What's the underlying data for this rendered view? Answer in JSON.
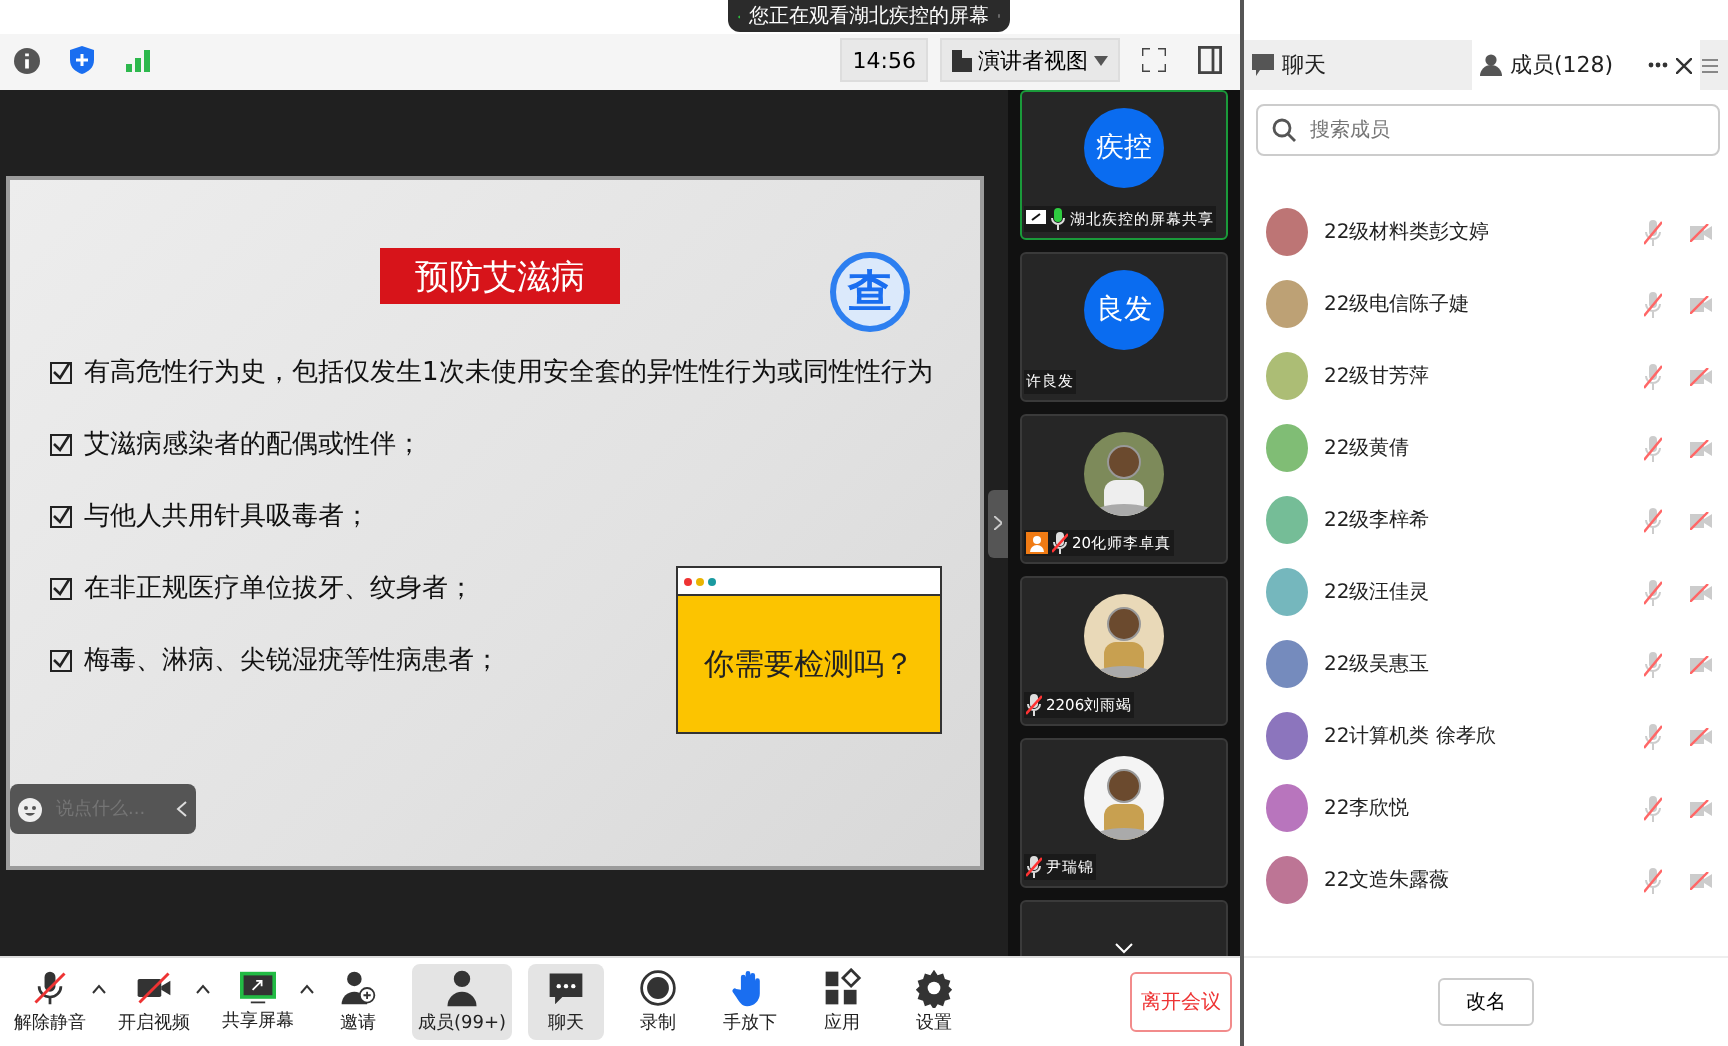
{
  "banner": {
    "text": "您正在观看湖北疾控的屏幕"
  },
  "toolbar": {
    "time": "14:56",
    "view": "演讲者视图"
  },
  "slide": {
    "title": "预防艾滋病",
    "stamp": "查",
    "items": [
      {
        "text": "有高危性行为史，包括仅发生1次未使用安全套的异性性行为或同性性行为",
        "checked": true
      },
      {
        "text": "艾滋病感染者的配偶或性伴；",
        "checked": true
      },
      {
        "text": "与他人共用针具吸毒者；",
        "checked": true
      },
      {
        "text": "在非正规医疗单位拔牙、纹身者；",
        "checked": true
      },
      {
        "text": "梅毒、淋病、尖锐湿疣等性病患者；",
        "checked": true
      }
    ],
    "callout": "你需要检测吗？"
  },
  "chat_input": {
    "placeholder": "说点什么..."
  },
  "videos": [
    {
      "name": "湖北疾控的屏幕共享",
      "avatar": "疾控",
      "kind": "text",
      "sharing": true,
      "mic_muted": false,
      "selected": true,
      "host": false
    },
    {
      "name": "许良发",
      "avatar": "良发",
      "kind": "text",
      "sharing": false,
      "selected": false,
      "host": false
    },
    {
      "name": "20化师李卓真",
      "kind": "picture",
      "sharing": false,
      "mic_muted": true,
      "selected": false,
      "host": true
    },
    {
      "name": "2206刘雨竭",
      "kind": "picture",
      "sharing": false,
      "mic_muted": true,
      "selected": false,
      "host": false
    },
    {
      "name": "尹瑞锦",
      "kind": "picture",
      "sharing": false,
      "mic_muted": true,
      "selected": false,
      "host": false
    }
  ],
  "controls": [
    {
      "label": "解除静音",
      "kind": "mic",
      "off": true,
      "selected": false,
      "caret": true
    },
    {
      "label": "开启视频",
      "kind": "camera",
      "off": true,
      "selected": false,
      "caret": true
    },
    {
      "label": "共享屏幕",
      "kind": "share",
      "selected": false,
      "caret": true
    },
    {
      "label": "邀请",
      "kind": "invite",
      "selected": false,
      "caret": false
    },
    {
      "label": "成员(99+)",
      "kind": "members",
      "selected": true,
      "caret": false
    },
    {
      "label": "聊天",
      "kind": "chat",
      "selected": true,
      "caret": false
    },
    {
      "label": "录制",
      "kind": "record",
      "selected": false,
      "caret": false
    },
    {
      "label": "手放下",
      "kind": "hand",
      "selected": false,
      "caret": false
    },
    {
      "label": "应用",
      "kind": "apps",
      "selected": false,
      "caret": false
    },
    {
      "label": "设置",
      "kind": "settings",
      "selected": false,
      "caret": false
    }
  ],
  "leave_button": "离开会议",
  "panel": {
    "tabs": [
      {
        "label": "聊天",
        "kind": "chat",
        "selected": false
      },
      {
        "label": "成员(128)",
        "kind": "members",
        "selected": true
      }
    ],
    "search": {
      "placeholder": "搜索成员"
    },
    "members": [
      {
        "name": "22级材料类彭文婷",
        "mic_muted": true,
        "camera_off": true
      },
      {
        "name": "22级电信陈子婕",
        "mic_muted": true,
        "camera_off": true
      },
      {
        "name": "22级甘芳萍",
        "mic_muted": true,
        "camera_off": true
      },
      {
        "name": "22级黄倩",
        "mic_muted": true,
        "camera_off": true
      },
      {
        "name": "22级李梓希",
        "mic_muted": true,
        "camera_off": true
      },
      {
        "name": "22级汪佳灵",
        "mic_muted": true,
        "camera_off": true
      },
      {
        "name": "22级吴惠玉",
        "mic_muted": true,
        "camera_off": true
      },
      {
        "name": "22计算机类 徐孝欣",
        "mic_muted": true,
        "camera_off": true
      },
      {
        "name": "22李欣悦",
        "mic_muted": true,
        "camera_off": true
      },
      {
        "name": "22文造朱露薇",
        "mic_muted": true,
        "camera_off": true
      }
    ],
    "rename_button": "改名"
  }
}
